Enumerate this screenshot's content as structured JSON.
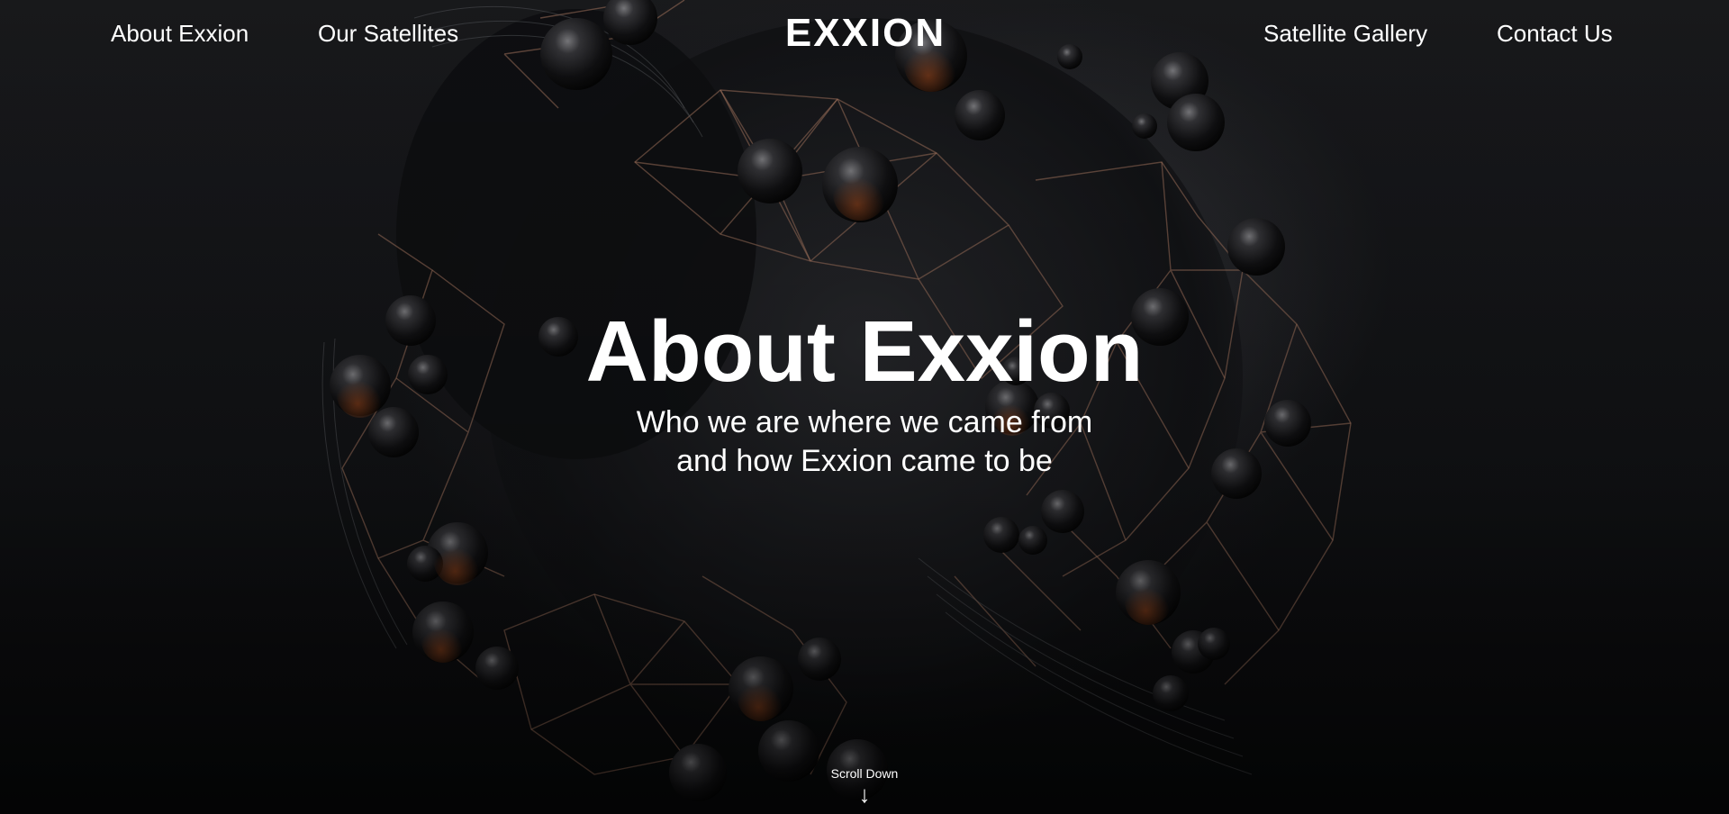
{
  "nav": {
    "left_links": [
      "About Exxion",
      "Our Satellites"
    ],
    "logo": "EXXION",
    "right_links": [
      "Satellite Gallery",
      "Contact Us"
    ]
  },
  "hero": {
    "title": "About Exxion",
    "subtitle_line1": "Who we are where we came from",
    "subtitle_line2": "and how Exxion came to be",
    "scroll_label": "Scroll Down",
    "scroll_icon": "arrow-down-icon"
  },
  "colors": {
    "background": "#0b0c0e",
    "text": "#ffffff",
    "wire_accent": "#b8836a",
    "sphere_glow": "#c2561e"
  }
}
